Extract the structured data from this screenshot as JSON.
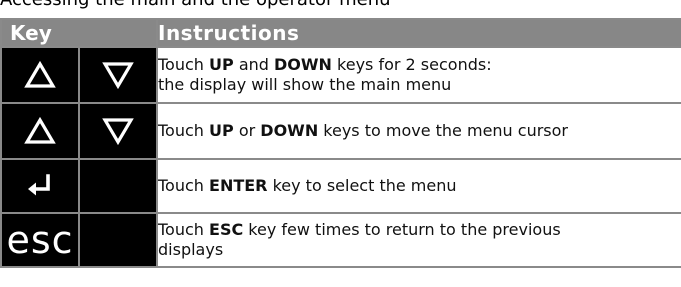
{
  "caption": "Accessing the main and the operator menu",
  "table": {
    "header": {
      "key": "Key",
      "instructions": "Instructions"
    },
    "rows": [
      {
        "icons": [
          "up-triangle-icon",
          "down-triangle-icon"
        ],
        "pre": "Touch ",
        "kw1": "UP",
        "mid": " and ",
        "kw2": "DOWN",
        "line1_post": " keys for 2 seconds:",
        "line2": "the display will show the main menu"
      },
      {
        "icons": [
          "up-triangle-icon",
          "down-triangle-icon"
        ],
        "pre": "Touch ",
        "kw1": "UP",
        "mid": " or ",
        "kw2": "DOWN",
        "post": " keys to move the menu cursor"
      },
      {
        "icons": [
          "enter-arrow-icon"
        ],
        "pre": "Touch ",
        "kw1": "ENTER",
        "post": " key to select the menu"
      },
      {
        "key_text": "esc",
        "pre": "Touch ",
        "kw1": "ESC",
        "line1_post": " key few times to return to the previous",
        "line2": "displays"
      }
    ]
  },
  "colors": {
    "header_bg": "#878787",
    "key_bg": "#000000",
    "border": "#9a9a9a"
  }
}
